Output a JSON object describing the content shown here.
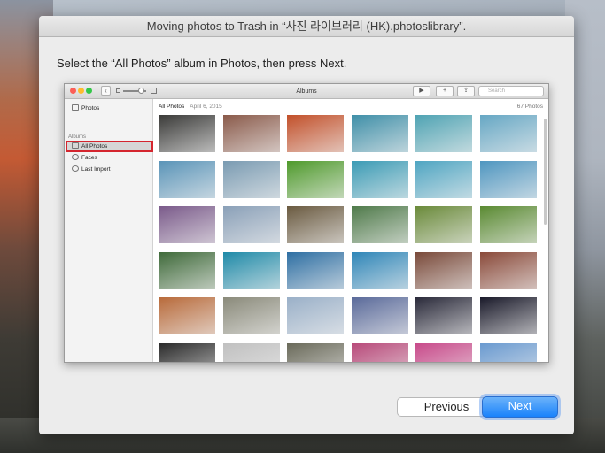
{
  "sheet": {
    "title": "Moving photos to Trash in “사진 라이브러리 (HK).photoslibrary”.",
    "instruction": "Select the “All Photos” album in Photos, then press Next."
  },
  "photos_window": {
    "title": "Albums",
    "search_placeholder": "Search",
    "sidebar": {
      "top_item": "Photos",
      "section": "Albums",
      "items": [
        "All Photos",
        "Faces",
        "Last Import"
      ]
    },
    "header": {
      "title": "All Photos",
      "date": "April 6, 2015",
      "count": "67 Photos"
    },
    "thumbnail_colors": [
      [
        "#3a3a38",
        "#8a5a4a",
        "#c2502a",
        "#3f8fa8",
        "#4fa3b3",
        "#66a7c4"
      ],
      [
        "#5a94b8",
        "#7a9bb2",
        "#4f9a2c",
        "#3b9bb5",
        "#4fa5c2",
        "#4f96c0"
      ],
      [
        "#7a5a8a",
        "#8aa0b8",
        "#6a5a40",
        "#4f7a4a",
        "#6a8a3a",
        "#5a8a32"
      ],
      [
        "#3f6a3a",
        "#1f8aa8",
        "#2e6fa3",
        "#2f86b8",
        "#7a4a3a",
        "#8a4a3a"
      ],
      [
        "#b86a3a",
        "#8a8a7a",
        "#9ab0c8",
        "#5a6a9a",
        "#2a2a3a",
        "#1a1a2a"
      ],
      [
        "#2a2a2a",
        "#c0c0c0",
        "#6a6a5a",
        "#b84a7a",
        "#c84a8a",
        "#6a9ad0"
      ]
    ]
  },
  "buttons": {
    "previous": "Previous",
    "next": "Next"
  },
  "colors": {
    "accent_blue": "#1a82fb",
    "selection_highlight": "#d4252e"
  }
}
